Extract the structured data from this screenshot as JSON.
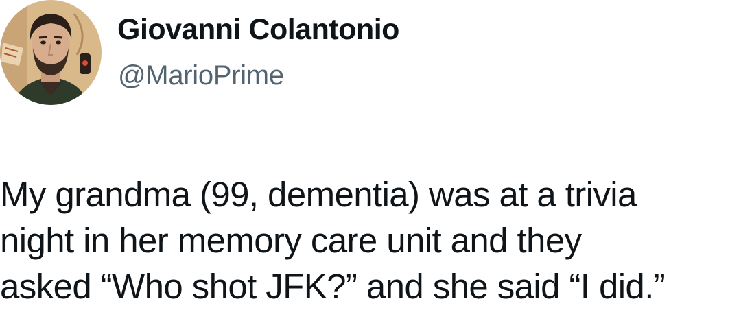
{
  "author": {
    "display_name": "Giovanni Colantonio",
    "handle": "@MarioPrime",
    "avatar_icon": "profile-photo",
    "handle_color": "#536471"
  },
  "tweet": {
    "lines": [
      "My grandma (99, dementia) was at a trivia",
      "night in her memory care unit and they",
      "asked “Who shot JFK?” and she said “I did.”"
    ]
  },
  "colors": {
    "text": "#0f1419",
    "background": "#ffffff"
  }
}
